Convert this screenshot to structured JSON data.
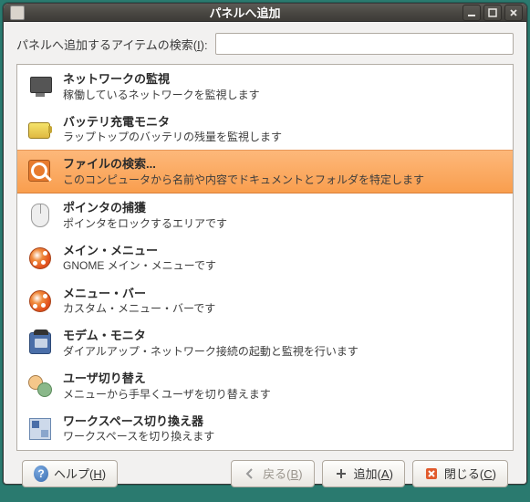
{
  "window": {
    "title": "パネルへ追加"
  },
  "search": {
    "label_pre": "パネルへ追加するアイテムの検索(",
    "label_mnemonic": "I",
    "label_post": "):",
    "value": ""
  },
  "items": [
    {
      "title": "ネットワークの監視",
      "desc": "稼働しているネットワークを監視します"
    },
    {
      "title": "バッテリ充電モニタ",
      "desc": "ラップトップのバッテリの残量を監視します"
    },
    {
      "title": "ファイルの検索...",
      "desc": "このコンピュータから名前や内容でドキュメントとフォルダを特定します"
    },
    {
      "title": "ポインタの捕獲",
      "desc": "ポインタをロックするエリアです"
    },
    {
      "title": "メイン・メニュー",
      "desc": "GNOME メイン・メニューです"
    },
    {
      "title": "メニュー・バー",
      "desc": "カスタム・メニュー・バーです"
    },
    {
      "title": "モデム・モニタ",
      "desc": "ダイアルアップ・ネットワーク接続の起動と監視を行います"
    },
    {
      "title": "ユーザ切り替え",
      "desc": "メニューから手早くユーザを切り替えます"
    },
    {
      "title": "ワークスペース切り換え器",
      "desc": "ワークスペースを切り換えます"
    }
  ],
  "selected_index": 2,
  "buttons": {
    "help": "ヘルプ",
    "help_mnemonic": "H",
    "back": "戻る",
    "back_mnemonic": "B",
    "add": "追加",
    "add_mnemonic": "A",
    "close": "閉じる",
    "close_mnemonic": "C"
  }
}
